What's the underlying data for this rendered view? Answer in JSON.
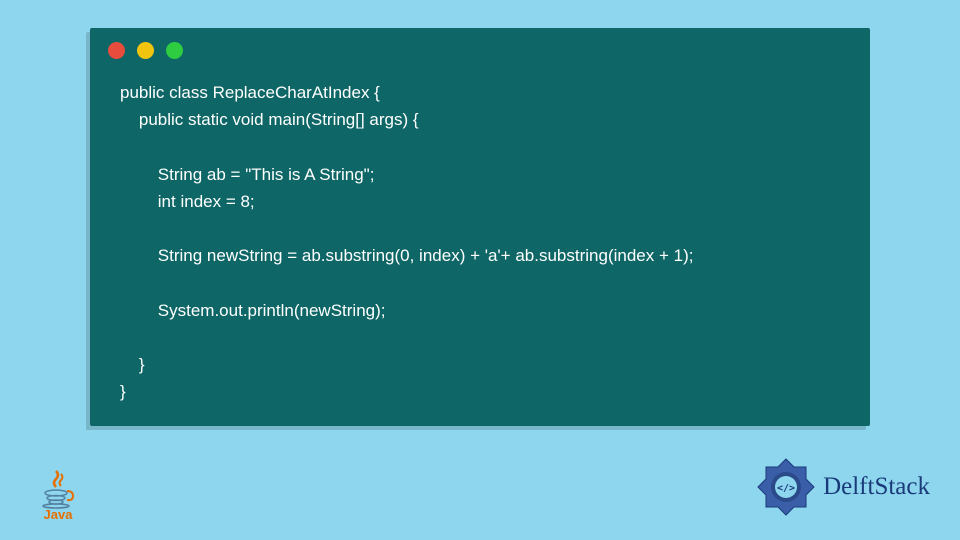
{
  "code": {
    "line1": "public class ReplaceCharAtIndex {",
    "line2": "    public static void main(String[] args) {",
    "line3": "",
    "line4": "        String ab = \"This is A String\";",
    "line5": "        int index = 8;",
    "line6": "",
    "line7": "        String newString = ab.substring(0, index) + 'a'+ ab.substring(index + 1);",
    "line8": "",
    "line9": "        System.out.println(newString);",
    "line10": "",
    "line11": "    }",
    "line12": "}"
  },
  "logos": {
    "java_label": "Java",
    "delft_label": "DelftStack"
  }
}
